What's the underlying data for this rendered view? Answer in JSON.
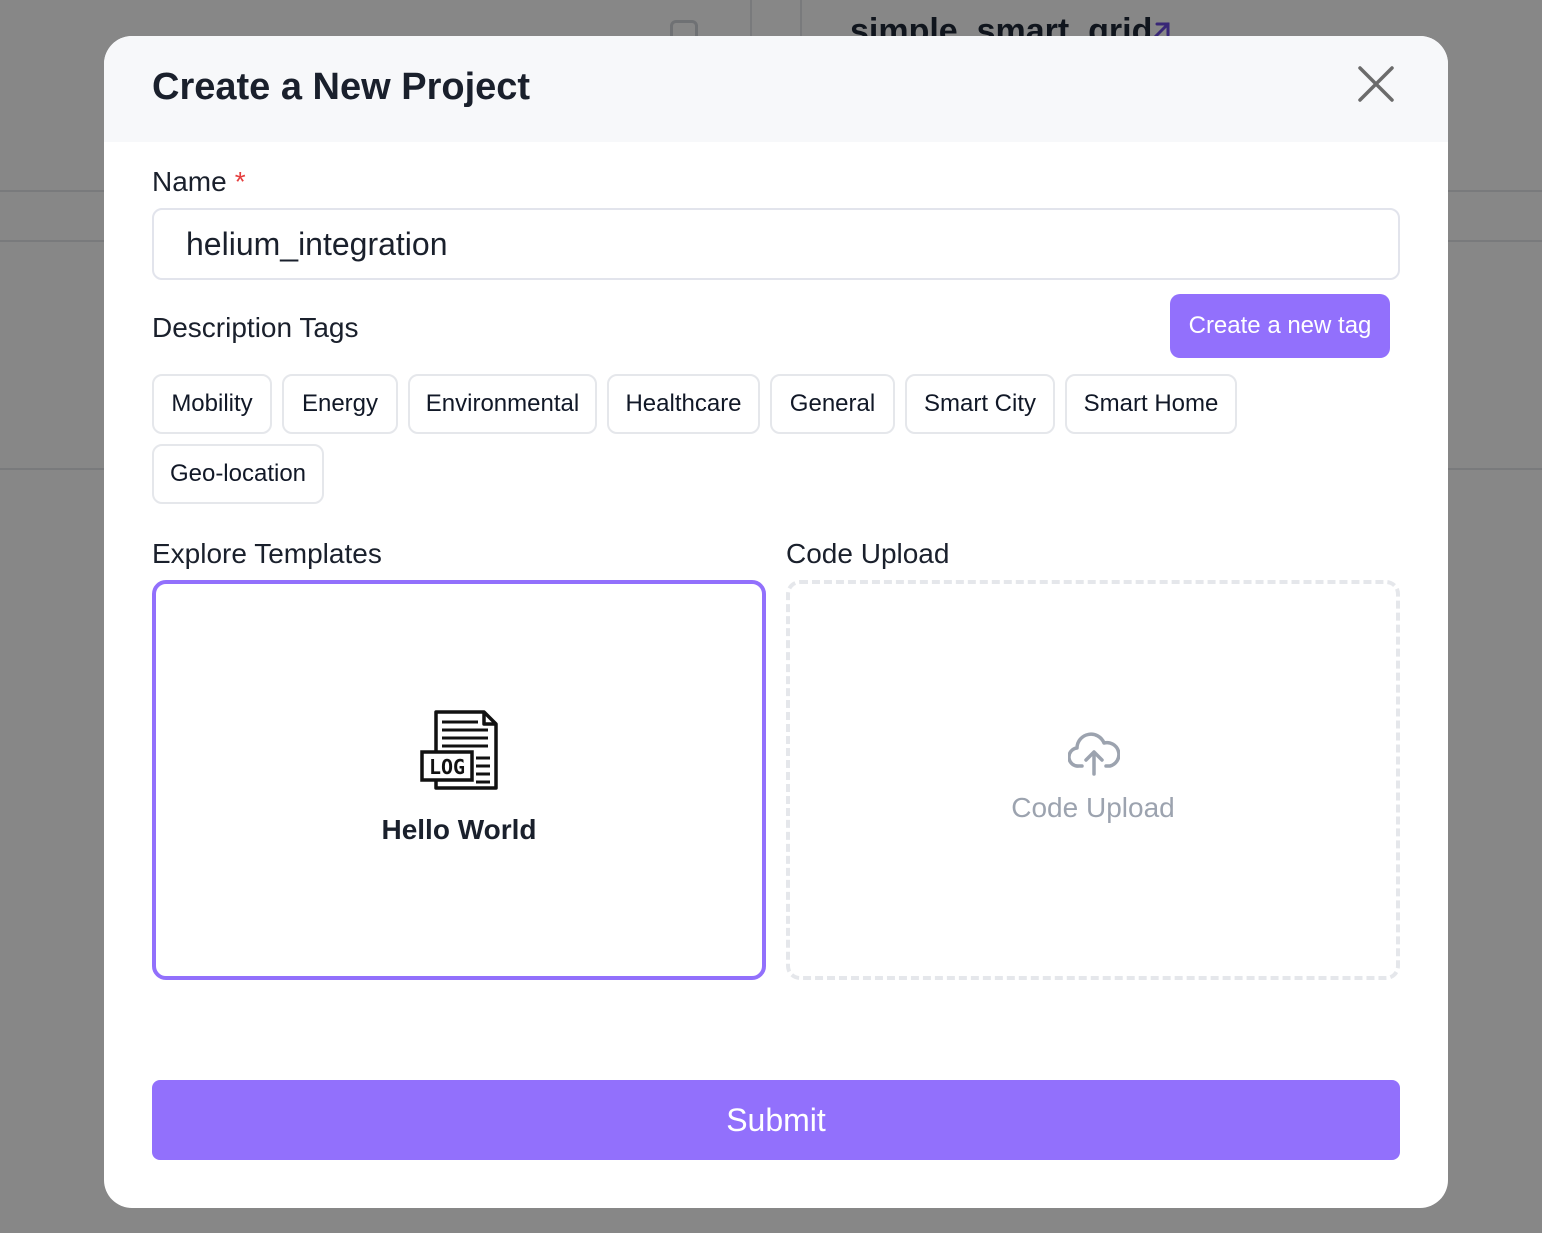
{
  "background": {
    "project_name": "simple_smart_grid"
  },
  "modal": {
    "title": "Create a New Project",
    "name_label": "Name",
    "required_marker": "*",
    "name_value": "helium_integration",
    "tags_label": "Description Tags",
    "new_tag_button": "Create a new tag",
    "tags": [
      "Mobility",
      "Energy",
      "Environmental",
      "Healthcare",
      "General",
      "Smart City",
      "Smart Home",
      "Geo-location"
    ],
    "templates_label": "Explore Templates",
    "template_card": {
      "icon_text": "LOG",
      "label": "Hello World"
    },
    "upload_label": "Code Upload",
    "upload_card_label": "Code Upload",
    "submit_button": "Submit"
  },
  "colors": {
    "accent": "#9270fc",
    "required": "#e53e3e",
    "overlay": "#888888"
  },
  "icons": {
    "close": "close-icon",
    "template": "log-file-icon",
    "upload": "cloud-upload-icon",
    "external_link": "external-link-icon"
  }
}
